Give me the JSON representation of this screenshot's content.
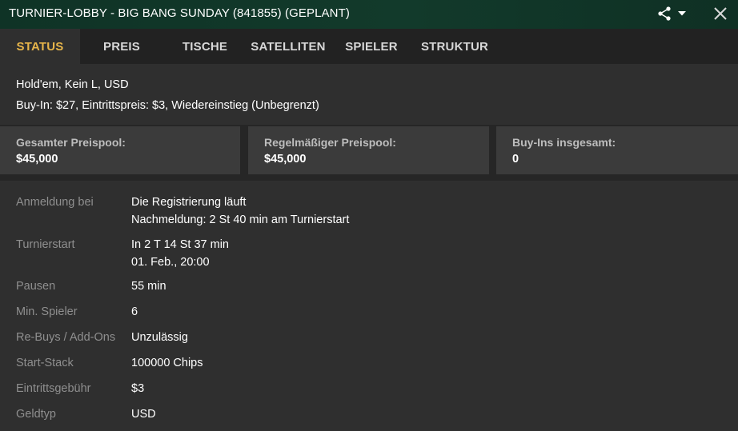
{
  "window": {
    "title": "TURNIER-LOBBY - BIG BANG SUNDAY (841855) (GEPLANT)",
    "share_icon": "share-icon",
    "dropdown_icon": "caret-down-icon",
    "close_icon": "close-icon"
  },
  "tabs": [
    {
      "label": "STATUS",
      "active": true
    },
    {
      "label": "PREIS",
      "active": false
    },
    {
      "label": "TISCHE",
      "active": false
    },
    {
      "label": "SATELLITEN",
      "active": false
    },
    {
      "label": "SPIELER",
      "active": false
    },
    {
      "label": "STRUKTUR",
      "active": false
    }
  ],
  "info": {
    "game": "Hold'em, Kein L, USD",
    "buyin": "Buy-In: $27, Eintrittspreis: $3, Wiedereinstieg (Unbegrenzt)"
  },
  "pools": [
    {
      "label": "Gesamter Preispool:",
      "value": "$45,000"
    },
    {
      "label": "Regelmäßiger Preispool:",
      "value": "$45,000"
    },
    {
      "label": "Buy-Ins insgesamt:",
      "value": "0"
    }
  ],
  "details": [
    {
      "label": "Anmeldung bei",
      "value": "Die Registrierung läuft",
      "value2": "Nachmeldung: 2 St 40 min am Turnierstart"
    },
    {
      "label": "Turnierstart",
      "value": "In 2 T 14 St 37 min",
      "value2": "01. Feb., 20:00"
    },
    {
      "label": "Pausen",
      "value": "55 min"
    },
    {
      "label": "Min. Spieler",
      "value": "6"
    },
    {
      "label": "Re-Buys / Add-Ons",
      "value": "Unzulässig"
    },
    {
      "label": "Start-Stack",
      "value": "100000 Chips"
    },
    {
      "label": "Eintrittsgebühr",
      "value": "$3"
    },
    {
      "label": "Geldtyp",
      "value": "USD"
    }
  ],
  "colors": {
    "titlebar": "#123a2b",
    "active_tab_text": "#e7b54a",
    "label_grey": "#8f8f8f"
  }
}
